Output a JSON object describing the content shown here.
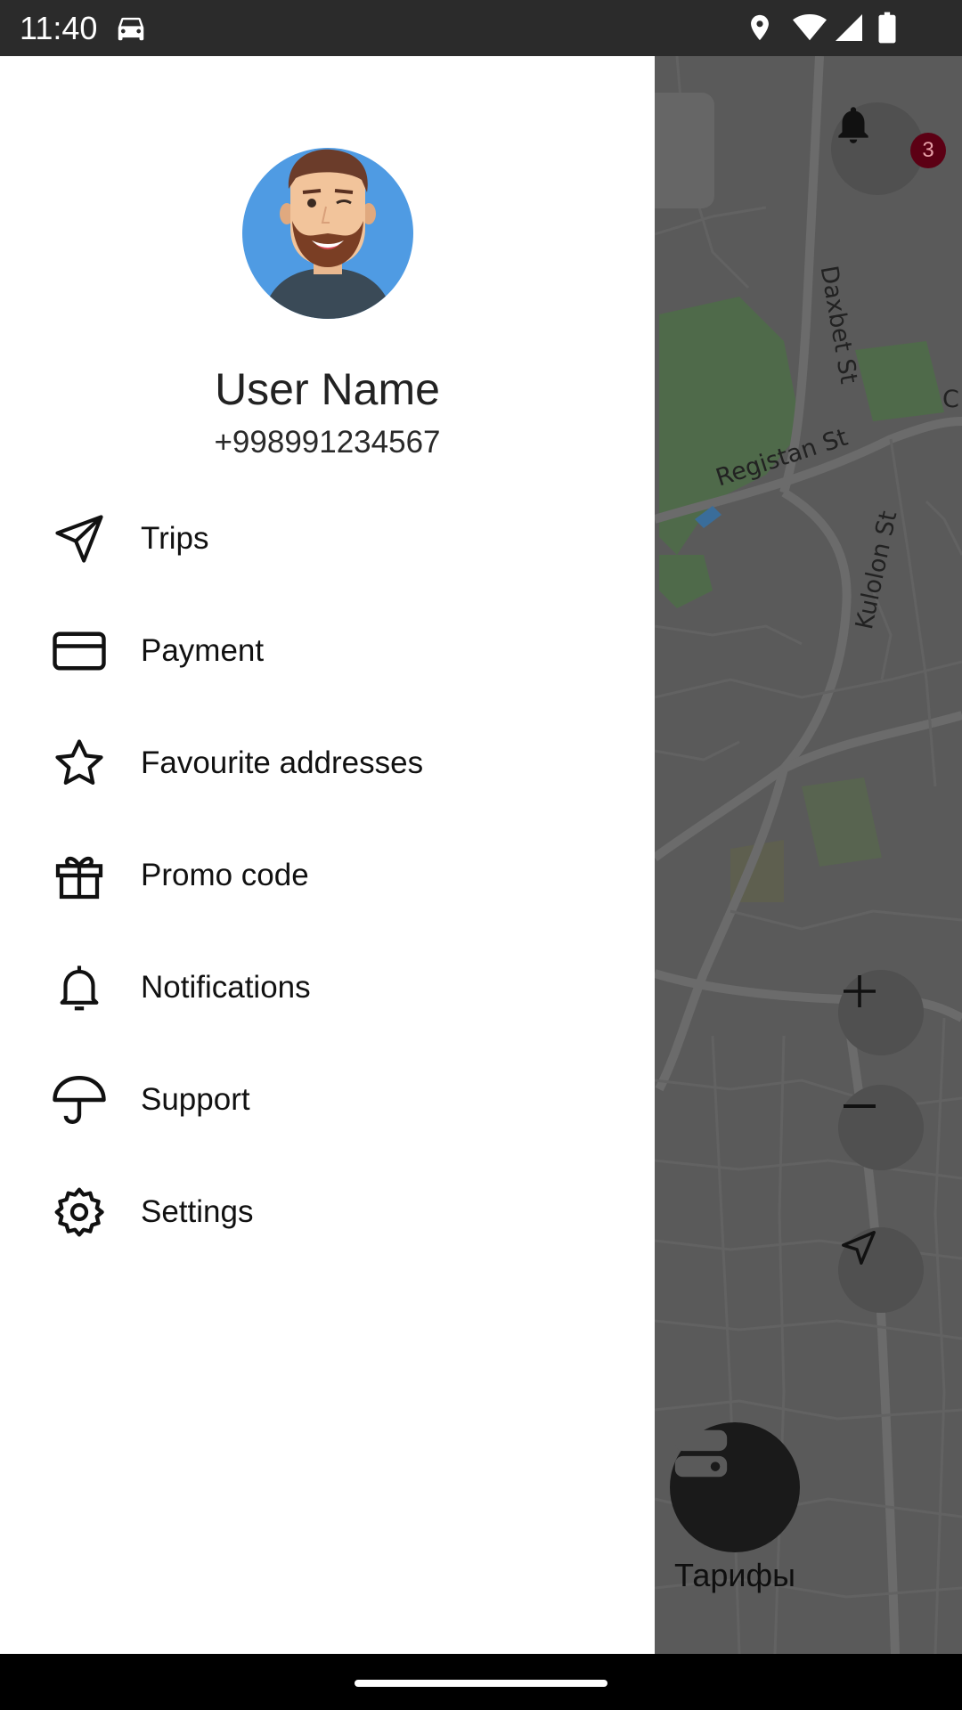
{
  "status_bar": {
    "time": "11:40"
  },
  "drawer": {
    "user_name": "User Name",
    "phone": "+998991234567",
    "menu": [
      {
        "label": "Trips",
        "icon": "send-icon"
      },
      {
        "label": "Payment",
        "icon": "credit-card-icon"
      },
      {
        "label": "Favourite addresses",
        "icon": "star-icon"
      },
      {
        "label": "Promo code",
        "icon": "gift-icon"
      },
      {
        "label": "Notifications",
        "icon": "bell-icon"
      },
      {
        "label": "Support",
        "icon": "umbrella-icon"
      },
      {
        "label": "Settings",
        "icon": "settings-icon"
      }
    ]
  },
  "map": {
    "streets": [
      "Daxbet St",
      "Registan St",
      "Kulolon St",
      "C"
    ],
    "notification_count": "3",
    "tariff_label": "Тарифы"
  },
  "colors": {
    "status_bar": "#2b2b2b",
    "drawer_bg": "#ffffff",
    "map_overlay": "#5a5a5a",
    "badge": "#5c0014",
    "avatar_bg": "#4f9be3"
  }
}
